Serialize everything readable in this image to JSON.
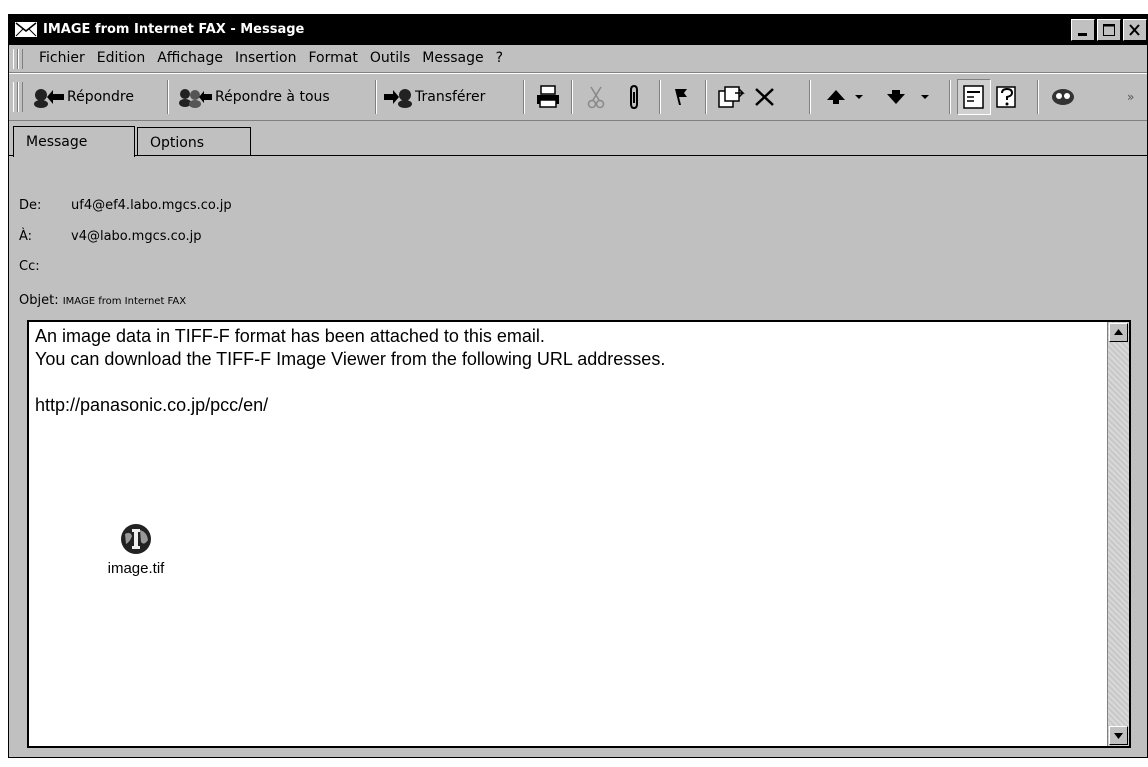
{
  "window": {
    "title": "IMAGE from Internet FAX - Message",
    "minimize_label": "_",
    "maximize_label": "□",
    "close_label": "×"
  },
  "menubar": {
    "items": [
      "Fichier",
      "Edition",
      "Affichage",
      "Insertion",
      "Format",
      "Outils",
      "Message",
      "?"
    ]
  },
  "toolbar": {
    "reply_label": "Répondre",
    "reply_all_label": "Répondre à tous",
    "forward_label": "Transférer",
    "icons": [
      "print-icon",
      "cut-icon",
      "attach-icon",
      "flag-icon",
      "copy-icon",
      "delete-icon",
      "previous-icon",
      "next-icon",
      "properties-icon",
      "address-icon",
      "encode-icon"
    ]
  },
  "tabs": {
    "message": "Message",
    "options": "Options"
  },
  "header": {
    "from_label": "De:",
    "from_value": "uf4@ef4.labo.mgcs.co.jp",
    "to_label": "À:",
    "to_value": "v4@labo.mgcs.co.jp",
    "cc_label": "Cc:",
    "cc_value": "",
    "subject_label": "Objet:",
    "subject_value": "IMAGE from Internet FAX"
  },
  "body": {
    "line1": "An image data in TIFF-F format has been attached to this email.",
    "line2": "You can download the TIFF-F Image Viewer from the following URL addresses.",
    "url": "http://panasonic.co.jp/pcc/en/"
  },
  "attachment": {
    "filename": "image.tif",
    "icon": "tiff-file-icon"
  },
  "colors": {
    "titlebar": "#000000",
    "window_bg": "#c0c0c0",
    "body_bg": "#ffffff"
  }
}
